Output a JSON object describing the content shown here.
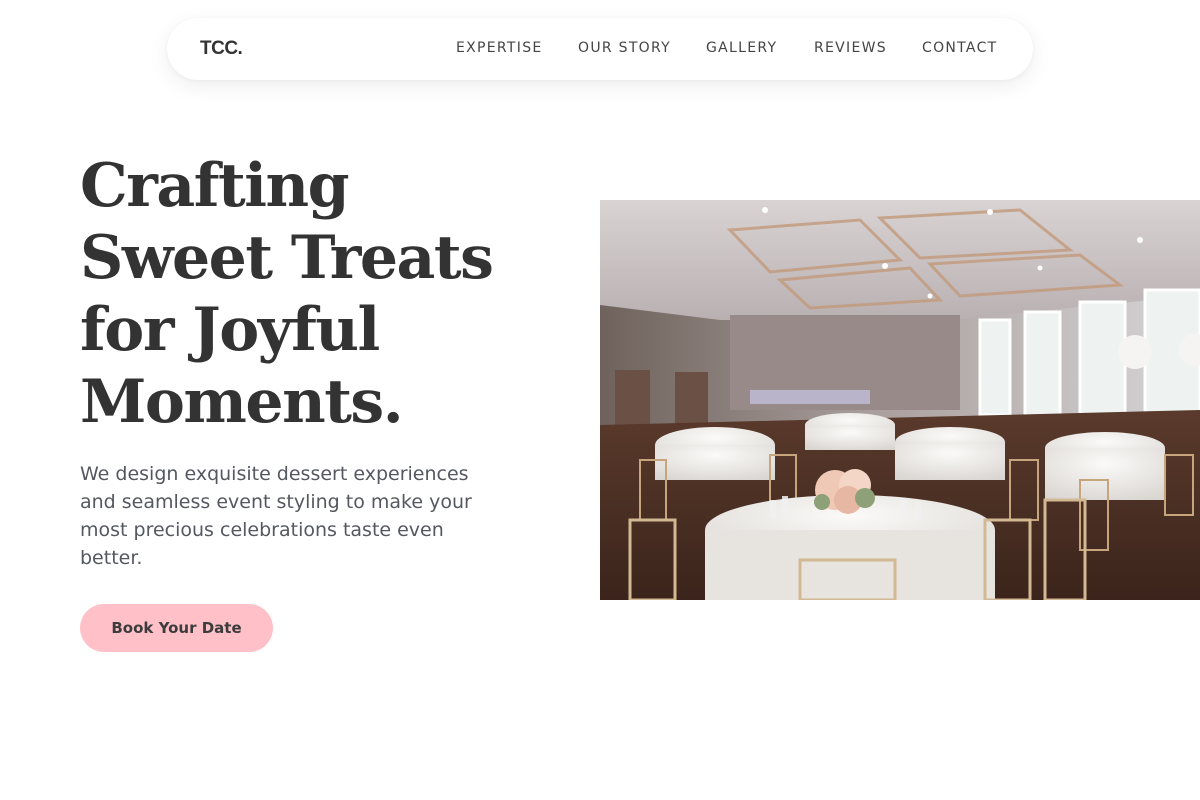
{
  "nav": {
    "brand": "TCC.",
    "links": [
      "EXPERTISE",
      "OUR STORY",
      "GALLERY",
      "REVIEWS",
      "CONTACT"
    ]
  },
  "hero": {
    "title_lines": [
      "Crafting",
      "Sweet Treats",
      "for Joyful",
      "Moments."
    ],
    "description": "We design exquisite dessert experiences and seamless event styling to make your most precious celebrations taste even better.",
    "cta_label": "Book Your Date",
    "image_subject": "banquet-hall-photo"
  },
  "colors": {
    "background": "#ffffff",
    "text_dark": "#333333",
    "text_muted": "#555860",
    "accent_pink": "#ffc0c8"
  }
}
